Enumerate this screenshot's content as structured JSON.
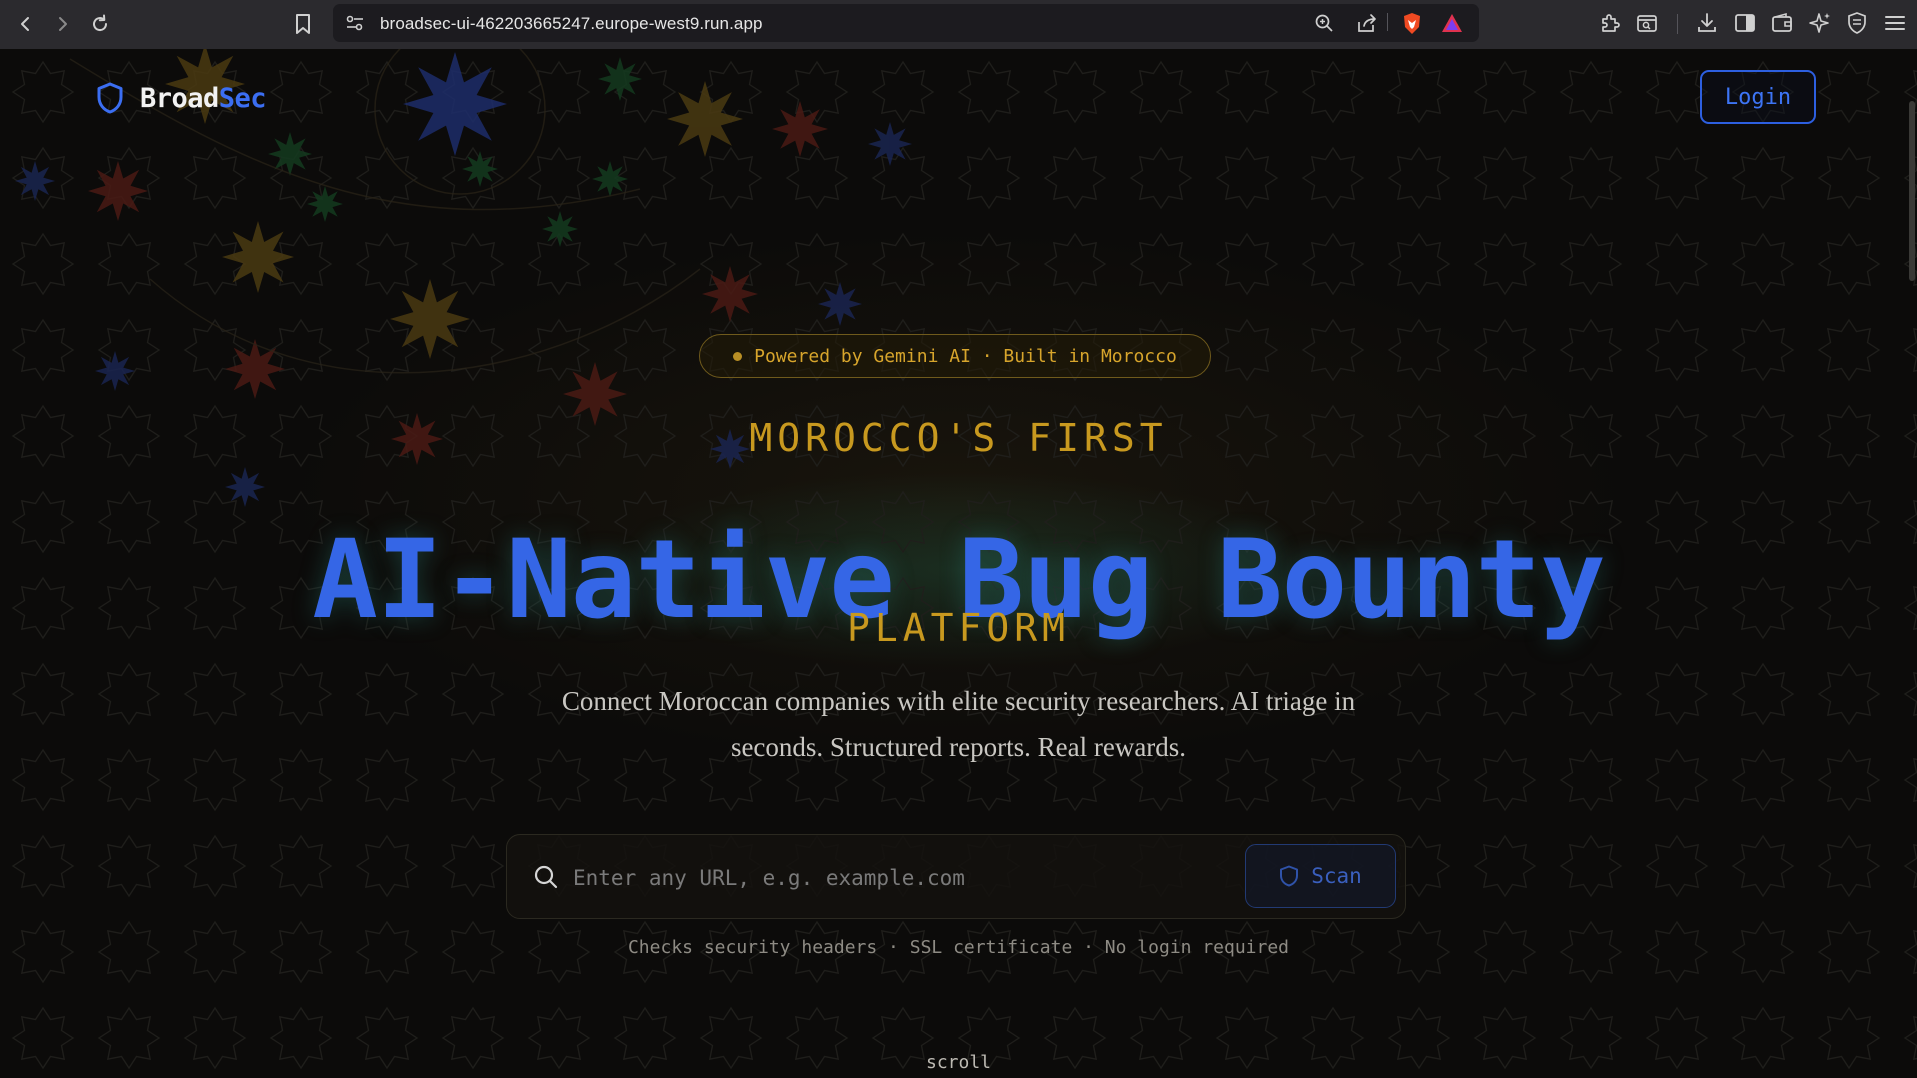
{
  "browser": {
    "url": "broadsec-ui-462203665247.europe-west9.run.app"
  },
  "brand": {
    "name_primary": "Broad",
    "name_accent": "Sec",
    "logo_icon": "shield-icon"
  },
  "header": {
    "login_label": "Login"
  },
  "hero": {
    "badge": "Powered by Gemini AI · Built in Morocco",
    "eyebrow": "MOROCCO'S FIRST",
    "title": "AI-Native Bug Bounty",
    "subtitle": "PLATFORM",
    "description": "Connect Moroccan companies with elite security researchers. AI triage in seconds. Structured reports. Real rewards."
  },
  "scan": {
    "placeholder": "Enter any URL, e.g. example.com",
    "value": "",
    "button_label": "Scan",
    "footnote": "Checks security headers · SSL certificate · No login required"
  },
  "scroll_hint": "scroll",
  "colors": {
    "accent_blue": "#3566e6",
    "accent_gold": "#c8991f",
    "background": "#0c0b0a"
  }
}
